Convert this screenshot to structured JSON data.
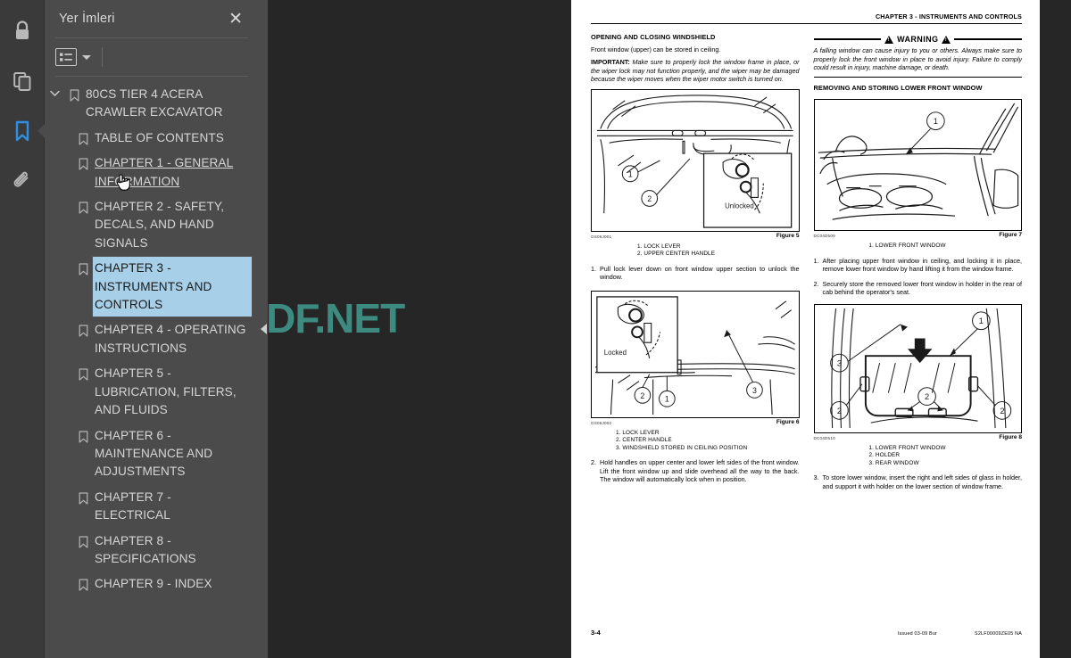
{
  "rail": {
    "items": [
      {
        "icon": "lock-icon",
        "label": "Security",
        "active": false
      },
      {
        "icon": "pages-icon",
        "label": "Page Thumbnails",
        "active": false
      },
      {
        "icon": "bookmark-icon",
        "label": "Bookmarks",
        "active": true
      },
      {
        "icon": "paperclip-icon",
        "label": "Attachments",
        "active": false
      }
    ]
  },
  "panel": {
    "title": "Yer İmleri",
    "close_label": "✕",
    "options_icon": "list-options-icon",
    "caret_icon": "chevron-down-icon"
  },
  "bookmarks": [
    {
      "label": "80CS TIER 4 ACERA CRAWLER EXCAVATOR",
      "level": 0,
      "expanded": true,
      "selected": false,
      "hovered": false
    },
    {
      "label": "TABLE OF CONTENTS",
      "level": 1,
      "selected": false,
      "hovered": false
    },
    {
      "label": "CHAPTER 1 - GENERAL INFORMATION",
      "level": 1,
      "selected": false,
      "hovered": true
    },
    {
      "label": "CHAPTER 2 - SAFETY, DECALS, AND HAND SIGNALS",
      "level": 1,
      "selected": false,
      "hovered": false
    },
    {
      "label": "CHAPTER 3 - INSTRUMENTS AND CONTROLS",
      "level": 1,
      "selected": true,
      "hovered": false
    },
    {
      "label": "CHAPTER 4 - OPERATING INSTRUCTIONS",
      "level": 1,
      "selected": false,
      "hovered": false
    },
    {
      "label": "CHAPTER 5 - LUBRICATION, FILTERS, AND FLUIDS",
      "level": 1,
      "selected": false,
      "hovered": false
    },
    {
      "label": "CHAPTER 6 - MAINTENANCE AND ADJUSTMENTS",
      "level": 1,
      "selected": false,
      "hovered": false
    },
    {
      "label": "CHAPTER 7 - ELECTRICAL",
      "level": 1,
      "selected": false,
      "hovered": false
    },
    {
      "label": "CHAPTER 8 - SPECIFICATIONS",
      "level": 1,
      "selected": false,
      "hovered": false
    },
    {
      "label": "CHAPTER 9 - INDEX",
      "level": 1,
      "selected": false,
      "hovered": false
    }
  ],
  "splitter": {
    "collapse_icon": "collapse-left-arrow-icon"
  },
  "watermark": {
    "text": "AUTOPDF.NET",
    "color": "#3d8a80"
  },
  "document": {
    "header": "CHAPTER 3 - INSTRUMENTS AND CONTROLS",
    "left_column": {
      "heading": "OPENING AND CLOSING WINDSHIELD",
      "intro": "Front window (upper) can be stored in ceiling.",
      "important_label": "IMPORTANT:",
      "important_text": " Make sure to properly lock the window frame in place, or the wiper lock may not function properly, and the wiper may be damaged because the wiper moves when the wiper motor switch is turned on.",
      "figure5": {
        "code": "GS06J001",
        "number": "Figure 5",
        "inset_label": "Unlocked",
        "callouts": [
          "1",
          "2"
        ],
        "legend": [
          "1. LOCK LEVER",
          "2. UPPER CENTER HANDLE"
        ]
      },
      "step1": {
        "n": "1.",
        "text": "Pull lock lever down on front window upper section to unlock the window."
      },
      "figure6": {
        "code": "GS06J002",
        "number": "Figure 6",
        "inset_label": "Locked",
        "callouts": [
          "1",
          "2",
          "3"
        ],
        "legend": [
          "1. LOCK LEVER",
          "2. CENTER HANDLE",
          "3. WINDSHIELD STORED IN CEILING POSITION"
        ]
      },
      "step2": {
        "n": "2.",
        "text": "Hold handles on upper center and lower left sides of the front window. Lift the front window up and slide overhead all the way to the back. The window will automatically lock when in position."
      }
    },
    "right_column": {
      "warning": {
        "title": "WARNING",
        "body": "A falling window can cause injury to you or others. Always make sure to properly lock the front window in place to avoid injury. Failure to comply could result in injury, machine damage, or death."
      },
      "heading": "REMOVING AND STORING LOWER FRONT WINDOW",
      "figure7": {
        "code": "DC04D509",
        "number": "Figure 7",
        "callouts": [
          "1"
        ],
        "legend": [
          "1. LOWER FRONT WINDOW"
        ]
      },
      "step1": {
        "n": "1.",
        "text": "After placing upper front window in ceiling, and locking it in place, remove lower front window by hand lifting it from the window frame."
      },
      "step2": {
        "n": "2.",
        "text": "Securely store the removed lower front window in holder in the rear of cab behind the operator's seat."
      },
      "figure8": {
        "code": "DC04D510",
        "number": "Figure 8",
        "callouts": [
          "1",
          "2",
          "3"
        ],
        "legend": [
          "1. LOWER FRONT WINDOW",
          "2. HOLDER",
          "3. REAR WINDOW"
        ]
      },
      "step3": {
        "n": "3.",
        "text": "To store lower window, insert the right and left sides of glass in holder, and support it with holder on the lower section of window frame."
      }
    },
    "footer": {
      "page_number": "3-4",
      "issued": "Issued 03-09   Bur",
      "doc_code": "S2LF00009ZE05 NA"
    }
  }
}
